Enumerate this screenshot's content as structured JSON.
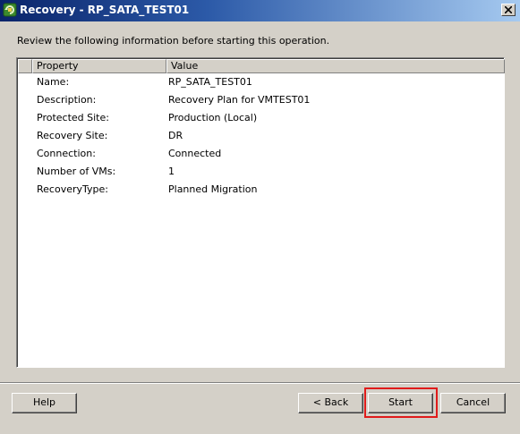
{
  "window": {
    "title": "Recovery - RP_SATA_TEST01",
    "icon": "recovery-plan-icon",
    "close_icon": "close-icon"
  },
  "intro_text": "Review the following information before starting this operation.",
  "table": {
    "columns": [
      "Property",
      "Value"
    ],
    "rows": [
      {
        "property": "Name:",
        "value": "RP_SATA_TEST01"
      },
      {
        "property": "Description:",
        "value": "Recovery Plan for VMTEST01"
      },
      {
        "property": "Protected Site:",
        "value": "Production (Local)"
      },
      {
        "property": "Recovery Site:",
        "value": "DR"
      },
      {
        "property": "Connection:",
        "value": "Connected"
      },
      {
        "property": "Number of VMs:",
        "value": "1"
      },
      {
        "property": "RecoveryType:",
        "value": "Planned Migration"
      }
    ]
  },
  "buttons": {
    "help": "Help",
    "back": "< Back",
    "start": "Start",
    "cancel": "Cancel"
  },
  "colors": {
    "title_bar": "#0a246a",
    "highlight": "#e01b1b",
    "dialog_bg": "#d4d0c8"
  }
}
